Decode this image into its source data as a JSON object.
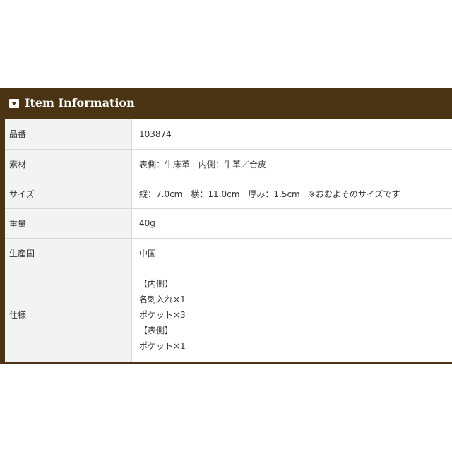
{
  "header": {
    "title": "Item Information",
    "icon": "caret-down-box-icon"
  },
  "colors": {
    "header_bg": "#4a3414",
    "label_bg": "#f3f3f3",
    "border": "#d8d8d8"
  },
  "rows": [
    {
      "label": "品番",
      "value": "103874"
    },
    {
      "label": "素材",
      "value": "表側：牛床革　内側：牛革／合皮"
    },
    {
      "label": "サイズ",
      "value": "縦：7.0cm　横：11.0cm　厚み：1.5cm　※おおよそのサイズです"
    },
    {
      "label": "重量",
      "value": "40g"
    },
    {
      "label": "生産国",
      "value": "中国"
    }
  ],
  "spec": {
    "label": "仕様",
    "lines": [
      "【内側】",
      "名刺入れ×1",
      "ポケット×3",
      "【表側】",
      "ポケット×1"
    ]
  }
}
